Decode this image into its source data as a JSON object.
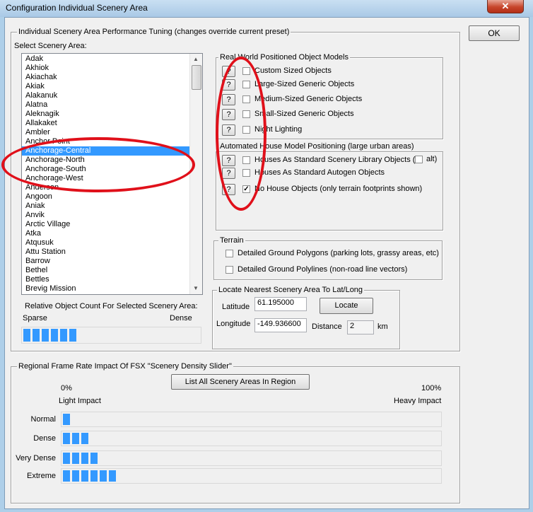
{
  "window": {
    "title": "Configuration Individual Scenery Area",
    "close_glyph": "✕"
  },
  "ok_button": "OK",
  "tuning": {
    "legend": "Individual Scenery Area Performance Tuning (changes override current preset)",
    "select_label": "Select Scenery Area:",
    "areas": [
      "Adak",
      "Akhiok",
      "Akiachak",
      "Akiak",
      "Alakanuk",
      "Alatna",
      "Aleknagik",
      "Allakaket",
      "Ambler",
      "Anchor Point",
      "Anchorage-Central",
      "Anchorage-North",
      "Anchorage-South",
      "Anchorage-West",
      "Anderson",
      "Angoon",
      "Aniak",
      "Anvik",
      "Arctic Village",
      "Atka",
      "Atqusuk",
      "Attu Station",
      "Barrow",
      "Bethel",
      "Bettles",
      "Brevig Mission"
    ],
    "selected_area": "Anchorage-Central",
    "scroll_up": "▲",
    "scroll_down": "▼",
    "relative_label": "Relative Object Count For Selected Scenery Area:",
    "sparse": "Sparse",
    "dense": "Dense",
    "relative_level": 6
  },
  "real_world": {
    "legend": "Real World Positioned Object Models",
    "items": [
      {
        "q": "?",
        "label": "Custom Sized Objects",
        "checked": false
      },
      {
        "q": "?",
        "label": "Large-Sized Generic Objects",
        "checked": false
      },
      {
        "q": "?",
        "label": "Medium-Sized Generic Objects",
        "checked": false
      },
      {
        "q": "?",
        "label": "Small-Sized Generic Objects",
        "checked": false
      },
      {
        "q": "?",
        "label": "Night Lighting",
        "checked": false
      }
    ]
  },
  "house": {
    "legend": "Automated House Model Positioning (large urban areas)",
    "items": [
      {
        "q": "?",
        "label": "Houses As Standard Scenery Library Objects (",
        "checked": false
      },
      {
        "q": "?",
        "label": "Houses As Standard Autogen Objects",
        "checked": false
      },
      {
        "q": "?",
        "label": "No House Objects (only terrain footprints shown)",
        "checked": true
      }
    ],
    "alt_label": "alt)",
    "alt_checked": false
  },
  "terrain": {
    "legend": "Terrain",
    "items": [
      {
        "label": "Detailed Ground Polygons (parking lots, grassy areas, etc)",
        "checked": false
      },
      {
        "label": "Detailed Ground Polylines (non-road line vectors)",
        "checked": false
      }
    ]
  },
  "locate": {
    "legend": "Locate Nearest Scenery Area To Lat/Long",
    "latitude_label": "Latitude",
    "latitude": "61.195000",
    "longitude_label": "Longitude",
    "longitude": "-149.936600",
    "button": "Locate",
    "distance_label": "Distance",
    "distance": "2",
    "km": "km"
  },
  "regional": {
    "legend": "Regional Frame Rate Impact Of FSX \"Scenery Density Slider\"",
    "list_button": "List All Scenery Areas In Region",
    "pct_low": "0%",
    "pct_high": "100%",
    "light": "Light Impact",
    "heavy": "Heavy Impact",
    "rows": [
      {
        "label": "Normal",
        "level": 1
      },
      {
        "label": "Dense",
        "level": 3
      },
      {
        "label": "Very Dense",
        "level": 4
      },
      {
        "label": "Extreme",
        "level": 6
      }
    ]
  },
  "annotation_color": "#e0101a"
}
